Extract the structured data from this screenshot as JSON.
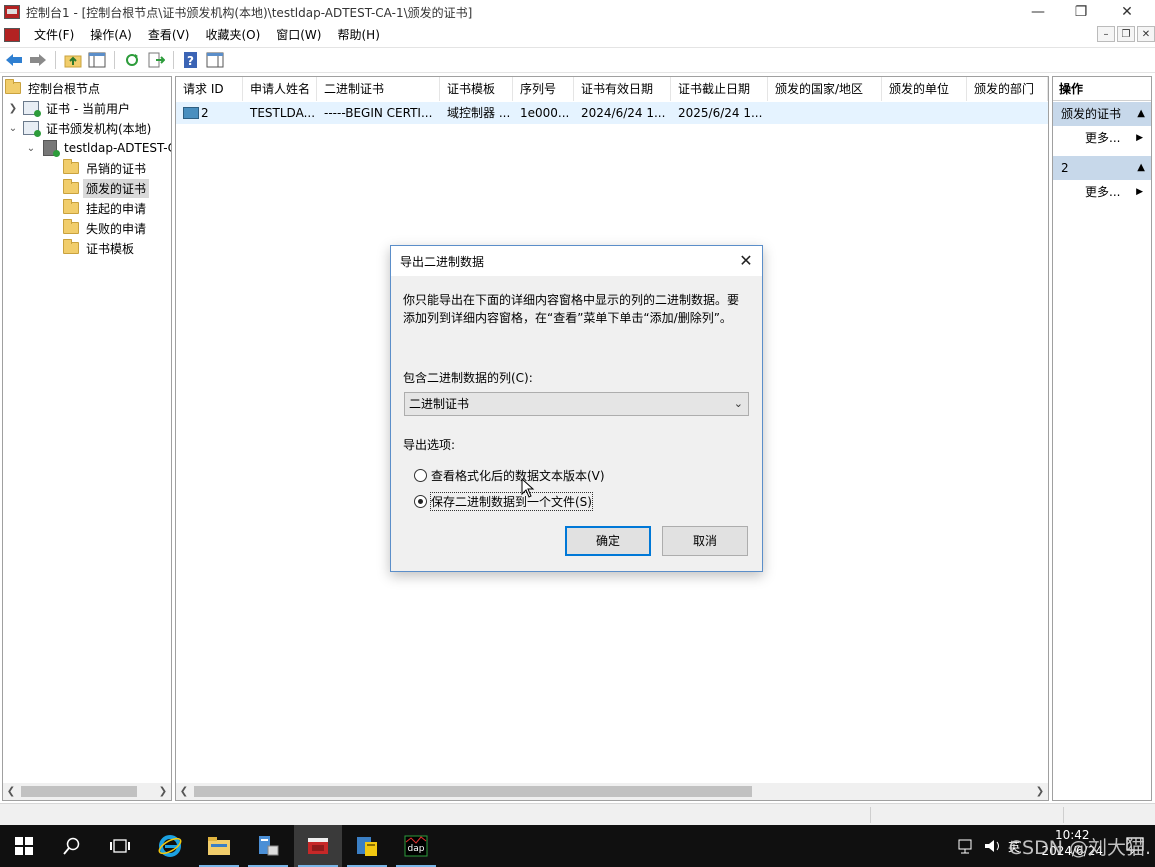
{
  "window": {
    "title": "控制台1 - [控制台根节点\\证书颁发机构(本地)\\testldap-ADTEST-CA-1\\颁发的证书]"
  },
  "menu": [
    "文件(F)",
    "操作(A)",
    "查看(V)",
    "收藏夹(O)",
    "窗口(W)",
    "帮助(H)"
  ],
  "tree": {
    "items": [
      {
        "label": "控制台根节点",
        "icon": "folder-icon"
      },
      {
        "label": "证书 - 当前用户",
        "icon": "certificates-icon"
      },
      {
        "label": "证书颁发机构(本地)",
        "icon": "certificates-icon"
      },
      {
        "label": "testldap-ADTEST-C",
        "icon": "ca-server-icon"
      },
      {
        "label": "吊销的证书",
        "icon": "folder-icon"
      },
      {
        "label": "颁发的证书",
        "icon": "folder-icon"
      },
      {
        "label": "挂起的申请",
        "icon": "folder-icon"
      },
      {
        "label": "失败的申请",
        "icon": "folder-icon"
      },
      {
        "label": "证书模板",
        "icon": "folder-icon"
      }
    ]
  },
  "list": {
    "columns": [
      "请求 ID",
      "申请人姓名",
      "二进制证书",
      "证书模板",
      "序列号",
      "证书有效日期",
      "证书截止日期",
      "颁发的国家/地区",
      "颁发的单位",
      "颁发的部门"
    ],
    "rows": [
      [
        "2",
        "TESTLDA...",
        "-----BEGIN CERTI...",
        "域控制器 ...",
        "1e000...",
        "2024/6/24 1...",
        "2025/6/24 1...",
        "",
        "",
        ""
      ]
    ]
  },
  "actions": {
    "title": "操作",
    "group1": "颁发的证书",
    "more1": "更多...",
    "group2": "2",
    "more2": "更多..."
  },
  "dialog": {
    "title": "导出二进制数据",
    "description_line1": "你只能导出在下面的详细内容窗格中显示的列的二进制数据。要",
    "description_line2": "添加列到详细内容窗格，在“查看”菜单下单击“添加/删除列”。",
    "column_label": "包含二进制数据的列(C):",
    "column_value": "二进制证书",
    "options_label": "导出选项:",
    "option1": "查看格式化后的数据文本版本(V)",
    "option2": "保存二进制数据到一个文件(S)",
    "selected_option": 2,
    "ok_label": "确定",
    "cancel_label": "取消"
  },
  "taskbar": {
    "time": "10:42",
    "date": "2024/6/24",
    "ime": "英",
    "watermark": "CSDN @刘大猫."
  },
  "colors": {
    "selection": "#e5f3ff",
    "action_group": "#c7d8ea",
    "accent": "#0078d7",
    "taskbar": "#101010"
  }
}
